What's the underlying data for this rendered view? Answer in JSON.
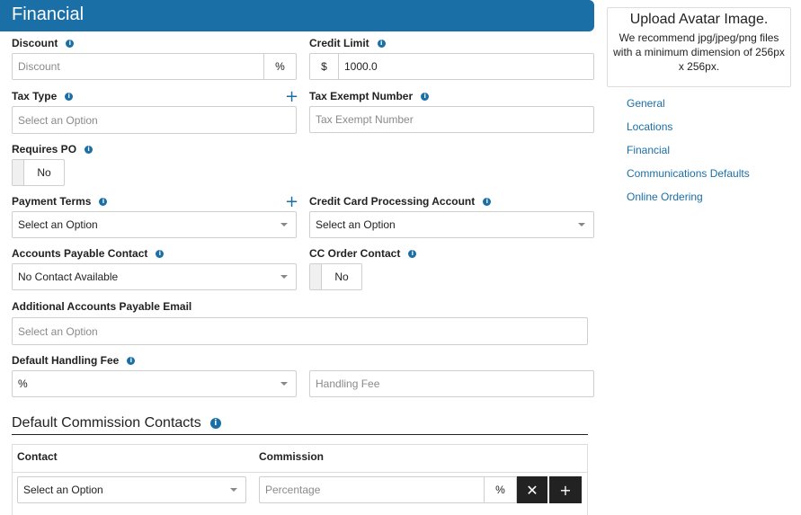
{
  "header": {
    "title": "Financial"
  },
  "fields": {
    "discount": {
      "label": "Discount",
      "placeholder": "Discount",
      "suffix": "%"
    },
    "credit_limit": {
      "label": "Credit Limit",
      "prefix": "$",
      "value": "1000.0"
    },
    "tax_type": {
      "label": "Tax Type",
      "placeholder": "Select an Option",
      "add_icon": "+"
    },
    "tax_exempt_number": {
      "label": "Tax Exempt Number",
      "placeholder": "Tax Exempt Number"
    },
    "requires_po": {
      "label": "Requires PO",
      "value": "No"
    },
    "payment_terms": {
      "label": "Payment Terms",
      "value": "Select an Option",
      "add_icon": "+"
    },
    "cc_processing_account": {
      "label": "Credit Card Processing Account",
      "value": "Select an Option"
    },
    "ap_contact": {
      "label": "Accounts Payable Contact",
      "value": "No Contact Available"
    },
    "cc_order_contact": {
      "label": "CC Order Contact",
      "value": "No"
    },
    "additional_ap_email": {
      "label": "Additional Accounts Payable Email",
      "placeholder": "Select an Option"
    },
    "default_handling_fee": {
      "label": "Default Handling Fee",
      "unit_value": "%",
      "placeholder": "Handling Fee"
    }
  },
  "commission": {
    "title": "Default Commission Contacts",
    "columns": [
      "Contact",
      "Commission"
    ],
    "row": {
      "contact_value": "Select an Option",
      "commission_placeholder": "Percentage",
      "suffix": "%",
      "remove_icon": "✕",
      "add_icon": "+"
    }
  },
  "avatar": {
    "title": "Upload Avatar Image.",
    "description": "We recommend jpg/jpeg/png files with a minimum dimension of 256px x 256px."
  },
  "nav": [
    "General",
    "Locations",
    "Financial",
    "Communications Defaults",
    "Online Ordering"
  ],
  "info_icon": "i",
  "colors": {
    "accent": "#1a6fa6",
    "dark_button": "#222222",
    "border": "#cfcfcf"
  }
}
